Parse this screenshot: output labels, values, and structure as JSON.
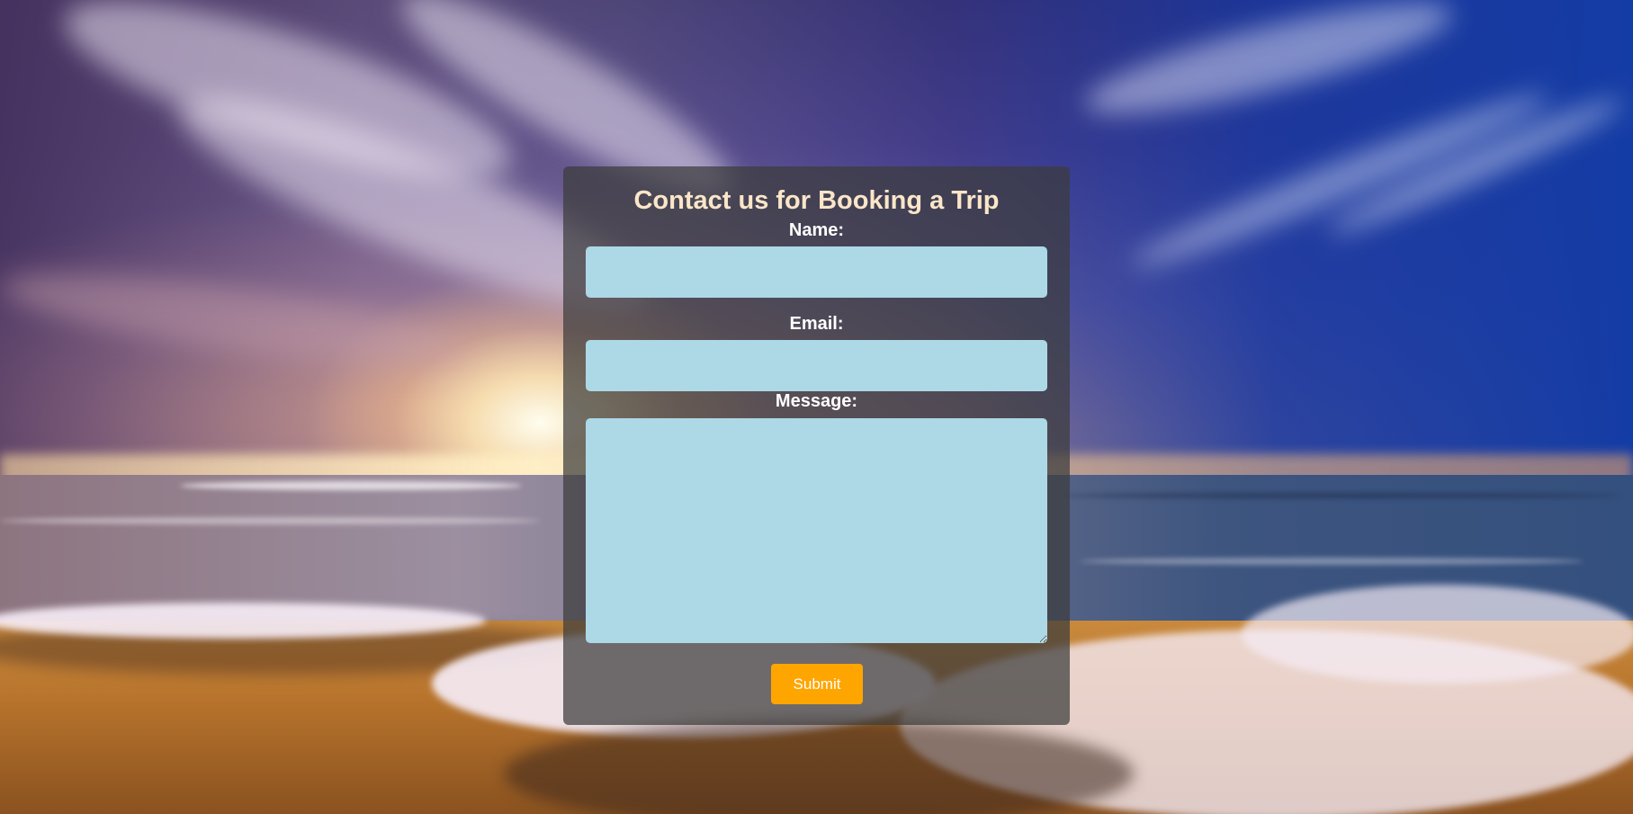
{
  "form": {
    "title": "Contact us for Booking a Trip",
    "name_label": "Name:",
    "name_value": "",
    "email_label": "Email:",
    "email_value": "",
    "message_label": "Message:",
    "message_value": "",
    "submit_label": "Submit"
  },
  "colors": {
    "panel_background": "#3c3c3c",
    "title_text": "#fae6c8",
    "field_background": "#add8e6",
    "submit_background": "#ffa500",
    "submit_text": "#ffffff"
  },
  "background": {
    "scene": "beach-sunset-photo"
  }
}
